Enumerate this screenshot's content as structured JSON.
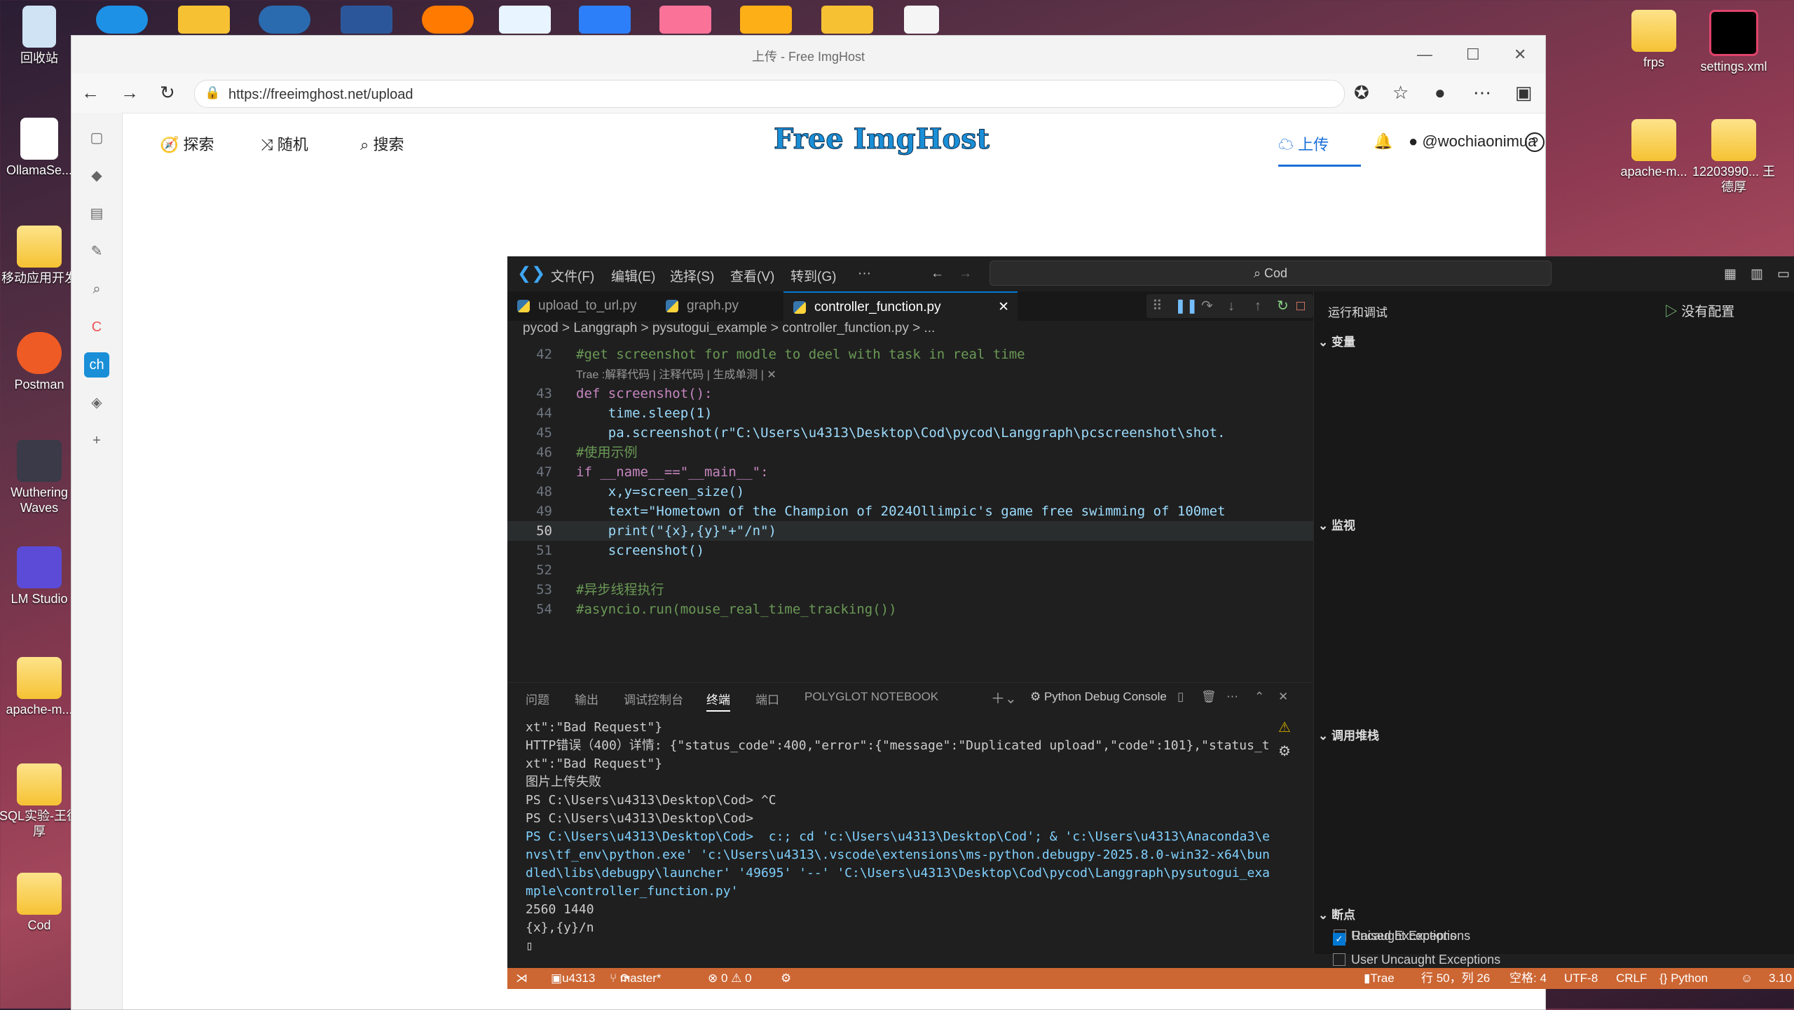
{
  "desktop": {
    "left_icons": [
      {
        "label": "回收站"
      },
      {
        "label": "OllamaSe..."
      },
      {
        "label": "移动应用开发"
      },
      {
        "label": "Postman"
      },
      {
        "label": "Wuthering Waves"
      },
      {
        "label": "LM Studio"
      },
      {
        "label": "apache-m..."
      },
      {
        "label": "SQL实验-王德厚"
      },
      {
        "label": "Cod"
      }
    ],
    "right_icons": [
      {
        "label": "frps"
      },
      {
        "label": "settings.xml"
      },
      {
        "label": "apache-m..."
      },
      {
        "label": "12203990... 王德厚"
      }
    ]
  },
  "browser": {
    "title": "上传 - Free ImgHost",
    "url": "https://freeimghost.net/upload",
    "nav": {
      "explore": "探索",
      "random": "随机",
      "search": "搜索"
    },
    "logo": "Free ImgHost",
    "upload": "上传",
    "user": "@wochiaonimua",
    "help": "?"
  },
  "vscode": {
    "menu": [
      "文件(F)",
      "编辑(E)",
      "选择(S)",
      "查看(V)",
      "转到(G)",
      "···"
    ],
    "search": "Cod",
    "tabs": [
      "upload_to_url.py",
      "graph.py",
      "controller_function.py"
    ],
    "breadcrumb": "pycod > Langgraph > pysutogui_example > controller_function.py > ...",
    "code_lines": [
      {
        "n": "42",
        "t": "#get screenshot for modle to deel with task in real time"
      },
      {
        "n": "",
        "t": "Trae :解释代码 | 注释代码 | 生成单测 | ✕"
      },
      {
        "n": "43",
        "t": "def screenshot():"
      },
      {
        "n": "44",
        "t": "    time.sleep(1)"
      },
      {
        "n": "45",
        "t": "    pa.screenshot(r\"C:\\Users\\u4313\\Desktop\\Cod\\pycod\\Langgraph\\pcscreenshot\\shot."
      },
      {
        "n": "46",
        "t": "#使用示例"
      },
      {
        "n": "47",
        "t": "if __name__==\"__main__\":"
      },
      {
        "n": "48",
        "t": "    x,y=screen_size()"
      },
      {
        "n": "49",
        "t": "    text=\"Hometown of the Champion of 2024Ollimpic's game free swimming of 100met"
      },
      {
        "n": "50",
        "t": "    print(\"{x},{y}\"+\"/n\")"
      },
      {
        "n": "51",
        "t": "    screenshot()"
      },
      {
        "n": "52",
        "t": ""
      },
      {
        "n": "53",
        "t": "#异步线程执行"
      },
      {
        "n": "54",
        "t": "#asyncio.run(mouse_real_time_tracking())"
      }
    ],
    "panel_tabs": [
      "问题",
      "输出",
      "调试控制台",
      "终端",
      "端口",
      "POLYGLOT NOTEBOOK"
    ],
    "panel_right": "Python Debug Console",
    "terminal": [
      "xt\":\"Bad Request\"}",
      "HTTP错误（400）详情: {\"status_code\":400,\"error\":{\"message\":\"Duplicated upload\",\"code\":101},\"status_txt\":\"Bad Request\"}",
      "图片上传失败",
      "PS C:\\Users\\u4313\\Desktop\\Cod> ^C",
      "PS C:\\Users\\u4313\\Desktop\\Cod>",
      "PS C:\\Users\\u4313\\Desktop\\Cod>  c:; cd 'c:\\Users\\u4313\\Desktop\\Cod'; & 'c:\\Users\\u4313\\Anaconda3\\envs\\tf_env\\python.exe' 'c:\\Users\\u4313\\.vscode\\extensions\\ms-python.debugpy-2025.8.0-win32-x64\\bundled\\libs\\debugpy\\launcher' '49695' '--' 'C:\\Users\\u4313\\Desktop\\Cod\\pycod\\Langgraph\\pysutogui_example\\controller_function.py'",
      "2560 1440",
      "{x},{y}/n"
    ],
    "run_debug": "运行和调试",
    "no_config": "没有配置",
    "sections": {
      "variables": "变量",
      "watch": "监视",
      "callstack": "调用堆栈",
      "breakpoints": "断点"
    },
    "breakpoints": [
      {
        "label": "Raised Exceptions",
        "checked": false
      },
      {
        "label": "Uncaught Exceptions",
        "checked": true
      },
      {
        "label": "User Uncaught Exceptions",
        "checked": false
      }
    ],
    "status": {
      "user": "u4313",
      "branch": "master*",
      "problems": "⊗ 0 ⚠ 0",
      "trae": "Trae",
      "position": "行 50，列 26",
      "spaces": "空格: 4",
      "encoding": "UTF-8",
      "eol": "CRLF",
      "language": "{} Python",
      "version": "3.10"
    }
  }
}
